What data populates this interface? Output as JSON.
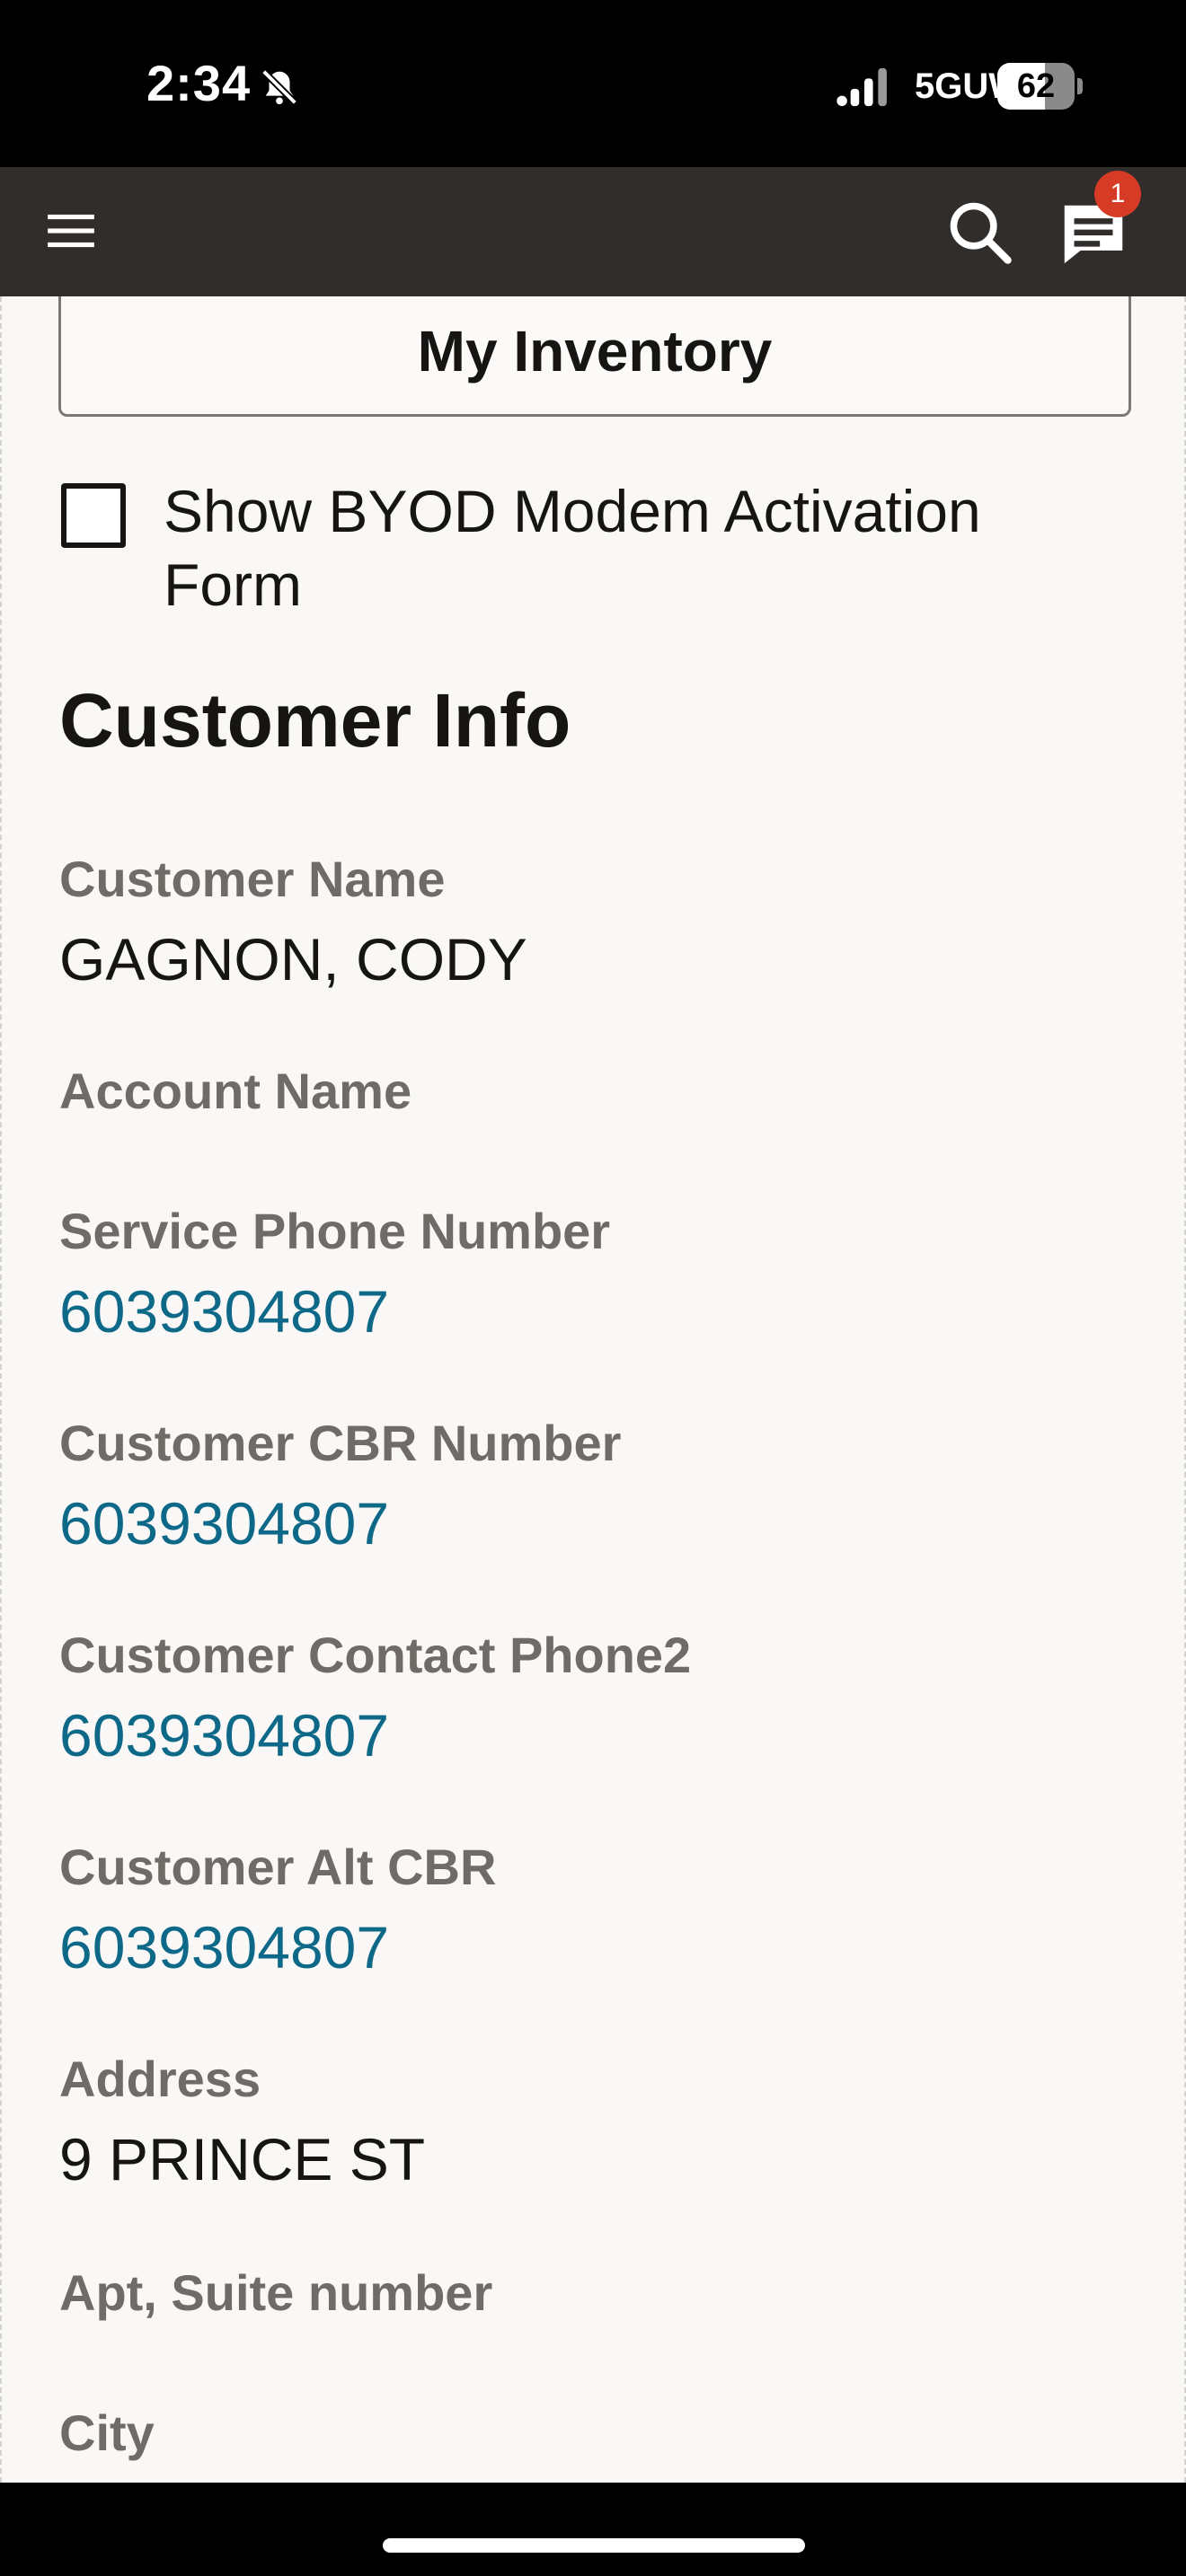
{
  "status_bar": {
    "time": "2:34",
    "network": "5GUW",
    "battery": "62",
    "battery_level": 0.62
  },
  "header": {
    "menu_icon": "hamburger-menu-icon",
    "search_icon": "search-icon",
    "messages_icon": "chat-icon",
    "notification_count": "1"
  },
  "actions": {
    "inventory_label": "My Inventory",
    "byod_checkbox_label": "Show BYOD Modem Activation Form",
    "byod_checked": false
  },
  "customer_info": {
    "title": "Customer Info",
    "fields": [
      {
        "label": "Customer Name",
        "value": "GAGNON, CODY"
      },
      {
        "label": "Account Name",
        "value": ""
      },
      {
        "label": "Service Phone Number",
        "value": "6039304807"
      },
      {
        "label": "Customer CBR Number",
        "value": "6039304807"
      },
      {
        "label": "Customer Contact Phone2",
        "value": "6039304807"
      },
      {
        "label": "Customer Alt CBR",
        "value": "6039304807"
      },
      {
        "label": "Address",
        "value": "9 PRINCE ST"
      },
      {
        "label": "Apt, Suite number",
        "value": ""
      },
      {
        "label": "City",
        "value": ""
      }
    ]
  },
  "colors": {
    "header_bg": "#312d2a",
    "link": "#0e6888",
    "badge": "#d63b25",
    "label": "#6f6b67"
  }
}
